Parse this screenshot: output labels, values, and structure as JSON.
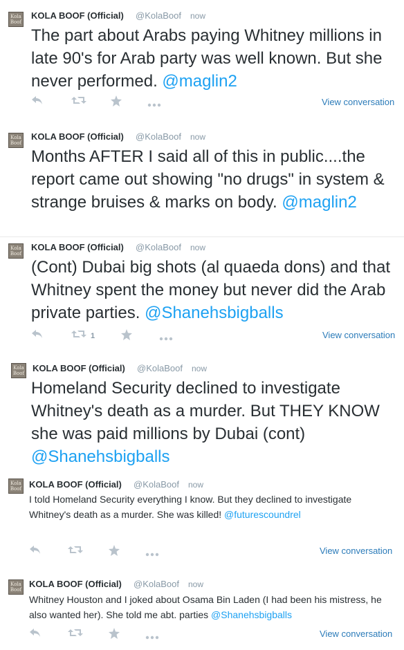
{
  "author": {
    "name": "KOLA BOOF (Official)",
    "handle": "@KolaBoof",
    "avatar_text_line1": "Kola",
    "avatar_text_line2": "Boof"
  },
  "actions": {
    "reply_icon": "reply-icon",
    "retweet_icon": "retweet-icon",
    "favorite_icon": "star-icon",
    "more_icon": "ellipsis-icon",
    "view_conversation": "View conversation"
  },
  "colors": {
    "link": "#1da1f2",
    "muted": "#8899a6",
    "text": "#292f33"
  },
  "tweets": [
    {
      "time": "now",
      "text": "The part about Arabs paying Whitney millions in late 90's for Arab party was well known. But she never performed. ",
      "mention": "@maglin2",
      "retweets": ""
    },
    {
      "time": "now",
      "text": "Months AFTER I said all of this in public....the report came out showing \"no drugs\" in system & strange bruises & marks on body. ",
      "mention": "@maglin2",
      "retweets": ""
    },
    {
      "time": "now",
      "text": "(Cont) Dubai big shots (al quaeda dons) and that Whitney spent the money but never did the Arab private parties. ",
      "mention": "@Shanehsbigballs",
      "retweets": "1"
    },
    {
      "time": "now",
      "text": "Homeland Security declined to investigate Whitney's death as a murder. But THEY KNOW she was paid millions by Dubai (cont) ",
      "mention": "@Shanehsbigballs",
      "retweets": ""
    },
    {
      "time": "now",
      "text": "I told Homeland Security everything I know. But they declined to investigate Whitney's death as a murder. She was killed! ",
      "mention": "@futurescoundrel",
      "retweets": ""
    },
    {
      "time": "now",
      "text": "Whitney Houston and I joked about Osama Bin Laden (I had been his mistress, he also wanted her). She told me abt. parties ",
      "mention": "@Shanehsbigballs",
      "retweets": ""
    }
  ]
}
